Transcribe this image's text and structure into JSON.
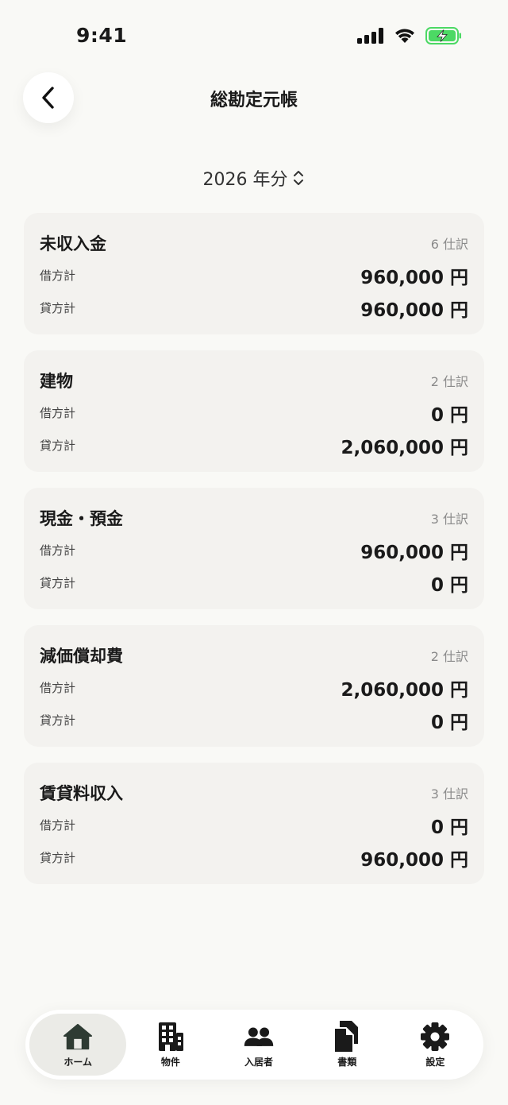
{
  "status_bar": {
    "time": "9:41"
  },
  "header": {
    "title": "総勘定元帳"
  },
  "year_selector": {
    "label": "2026 年分"
  },
  "row_labels": {
    "debit": "借方計",
    "credit": "貸方計"
  },
  "accounts": [
    {
      "name": "未収入金",
      "entries": "6 仕訳",
      "debit": "960,000 円",
      "credit": "960,000 円"
    },
    {
      "name": "建物",
      "entries": "2 仕訳",
      "debit": "0 円",
      "credit": "2,060,000 円"
    },
    {
      "name": "現金・預金",
      "entries": "3 仕訳",
      "debit": "960,000 円",
      "credit": "0 円"
    },
    {
      "name": "減価償却費",
      "entries": "2 仕訳",
      "debit": "2,060,000 円",
      "credit": "0 円"
    },
    {
      "name": "賃貸料収入",
      "entries": "3 仕訳",
      "debit": "0 円",
      "credit": "960,000 円"
    }
  ],
  "tabs": [
    {
      "label": "ホーム",
      "icon": "home-icon",
      "active": true
    },
    {
      "label": "物件",
      "icon": "building-icon"
    },
    {
      "label": "入居者",
      "icon": "people-icon"
    },
    {
      "label": "書類",
      "icon": "documents-icon"
    },
    {
      "label": "設定",
      "icon": "gear-icon"
    }
  ],
  "colors": {
    "background": "#f9f9f6",
    "card": "#f3f2ef",
    "active_tab": "#ebebe7",
    "battery": "#4cd964"
  }
}
